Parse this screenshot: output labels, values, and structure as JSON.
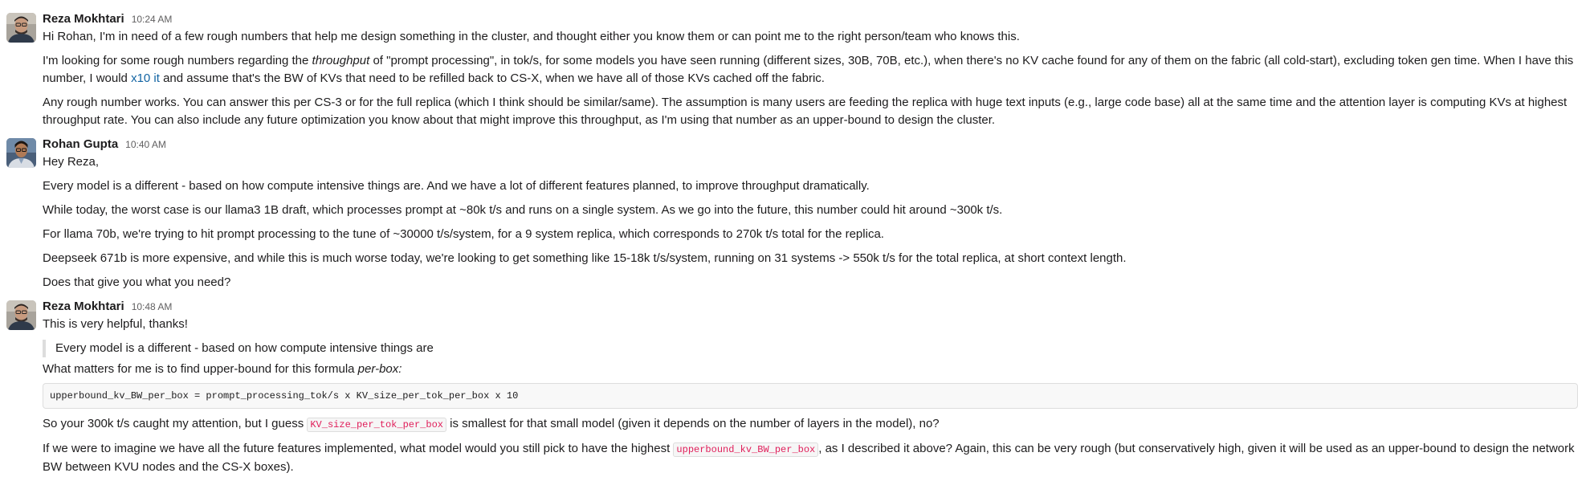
{
  "messages": [
    {
      "sender": "Reza Mokhtari",
      "time": "10:24 AM",
      "p1": "Hi Rohan, I'm in need of a few rough numbers that help me design something in the cluster, and thought either you know them or can point me to the right person/team who knows this.",
      "p2_a": "I'm looking for some rough numbers regarding the ",
      "p2_em": "throughput",
      "p2_b": " of \"prompt processing\", in tok/s, for some models you have seen running (different sizes, 30B, 70B, etc.), when there's no KV cache found for any of them on the fabric (all cold-start), excluding token gen time. When I have this number, I would ",
      "p2_link": "x10 it",
      "p2_c": " and assume that's the BW of KVs that need to be refilled back to CS-X, when we have all of those KVs cached off the fabric.",
      "p3": "Any rough number works. You can answer this per CS-3 or for the full replica (which I think should be similar/same). The assumption is many users are feeding the replica with huge text inputs (e.g., large code base) all at the same time and the attention layer is computing KVs at highest throughput rate. You can also include any future optimization you know about that might improve this throughput, as I'm using that number as an upper-bound to design the cluster."
    },
    {
      "sender": "Rohan Gupta",
      "time": "10:40 AM",
      "p1": "Hey Reza,",
      "p2": "Every model is a different - based on how compute intensive things are. And we have a lot of different features planned, to improve throughput dramatically.",
      "p3": "While today, the worst case is our llama3 1B draft, which processes prompt at ~80k t/s and runs on a single system. As we go into the future, this number could hit around ~300k t/s.",
      "p4": "For llama 70b, we're trying to hit prompt processing to the tune of ~30000 t/s/system, for a 9 system replica, which corresponds to 270k t/s total for the replica.",
      "p5": "Deepseek 671b is more expensive, and while this is much worse today, we're looking to get something like 15-18k t/s/system, running on 31 systems -> 550k t/s for the total replica, at short context length.",
      "p6": "Does that give you what you need?"
    },
    {
      "sender": "Reza Mokhtari",
      "time": "10:48 AM",
      "p1": "This is very helpful, thanks!",
      "quote": "Every model is a different - based on how compute intensive things are",
      "p2_a": "What matters for me is to find upper-bound for this formula ",
      "p2_em": "per-box:",
      "code": "upperbound_kv_BW_per_box = prompt_processing_tok/s x KV_size_per_tok_per_box x 10",
      "p3_a": "So your 300k t/s caught my attention, but I guess ",
      "p3_code": "KV_size_per_tok_per_box",
      "p3_b": " is smallest for that small model (given it depends on the number of layers in the model), no?",
      "p4_a": "If we were to imagine we have all the future features implemented, what model would you still pick to have the highest ",
      "p4_code": "upperbound_kv_BW_per_box",
      "p4_b": ", as I described it above? Again, this can be very rough (but conservatively high, given it will be used as an upper-bound to design the network BW between KVU nodes and the CS-X boxes)."
    }
  ],
  "colors": {
    "link": "#1264a3",
    "inline_code": "#e01e5a",
    "text": "#1d1c1d",
    "meta": "#616061"
  },
  "icons": {
    "avatar_reza": "avatar-photo",
    "avatar_rohan": "avatar-photo"
  }
}
